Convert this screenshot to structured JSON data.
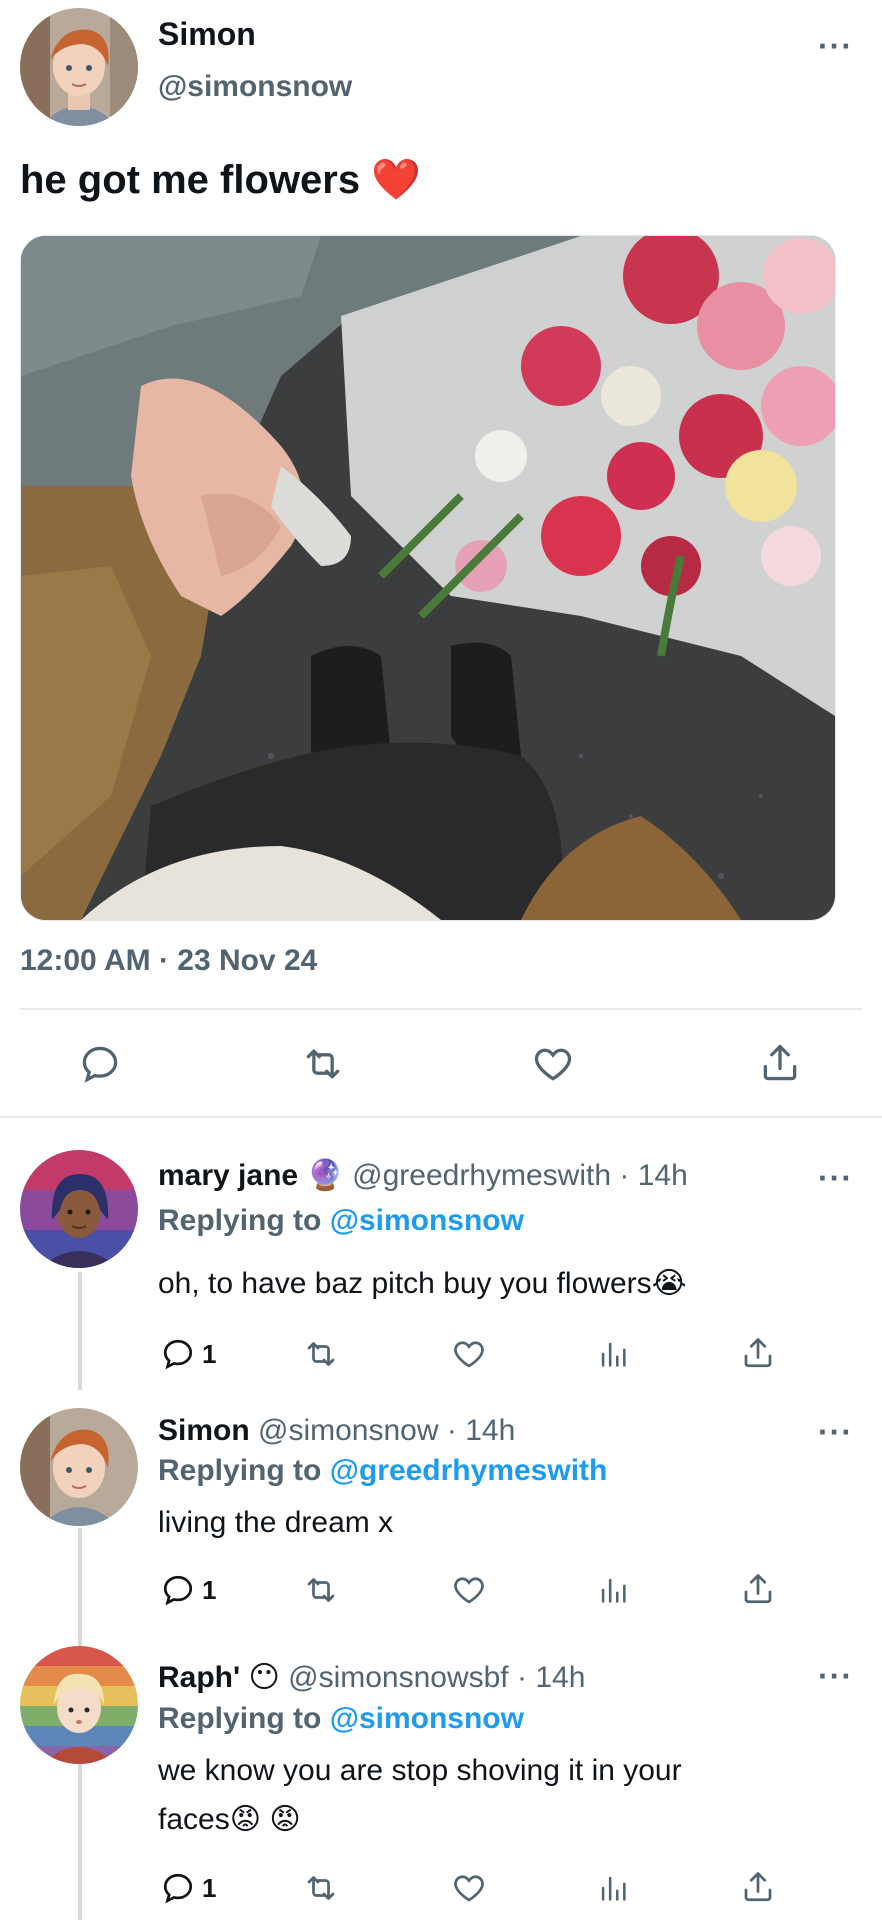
{
  "main_tweet": {
    "display_name": "Simon",
    "handle": "@simonsnow",
    "text": "he got me flowers",
    "emoji": "❤️",
    "timestamp": "12:00 AM · 23 Nov 24",
    "more": "···"
  },
  "replies": [
    {
      "display_name": "mary jane",
      "badge": "🔮",
      "handle": "@greedrhymeswith",
      "time": "· 14h",
      "replying_prefix": "Replying to",
      "replying_to": "@simonsnow",
      "text": "oh, to have baz pitch buy you flowers😭",
      "reply_count": "1",
      "more": "···"
    },
    {
      "display_name": "Simon",
      "badge": "",
      "handle": "@simonsnow",
      "time": "· 14h",
      "replying_prefix": "Replying to",
      "replying_to": "@greedrhymeswith",
      "text": "living the dream x",
      "reply_count": "1",
      "more": "···"
    },
    {
      "display_name": "Raph'",
      "badge": "😶",
      "handle": "@simonsnowsbf",
      "time": "· 14h",
      "replying_prefix": "Replying to",
      "replying_to": "@simonsnow",
      "text_line1": "we know you are stop shoving it in your",
      "text_line2": "faces😡 😡",
      "reply_count": "1",
      "more": "···"
    }
  ],
  "colors": {
    "accent": "#1d9bf0",
    "secondary_text": "#536471",
    "heart": "#e0245e"
  }
}
